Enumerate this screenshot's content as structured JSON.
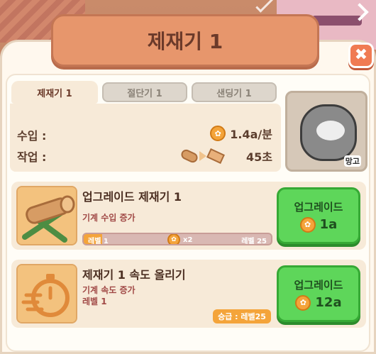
{
  "window": {
    "title": "제재기 1"
  },
  "tabs": [
    {
      "label": "제재기 1",
      "active": true
    },
    {
      "label": "절단기 1",
      "active": false
    },
    {
      "label": "샌딩기 1",
      "active": false
    }
  ],
  "stats": {
    "income_label": "수입 :",
    "income_value": "1.4a/분",
    "work_label": "작업 :",
    "work_value": "45초"
  },
  "worker": {
    "name": "망고"
  },
  "upgrades": [
    {
      "title": "업그레이드 제재기 1",
      "description": "기계 수입 증가",
      "level_left": "레벨 1",
      "level_mid": "x2",
      "level_right": "레벨 25",
      "progress_fraction": 0.1,
      "button_label": "업그레이드",
      "cost": "1a"
    },
    {
      "title": "제재기 1 속도 올리기",
      "description": "기계 속도 증가",
      "level": "레벨 1",
      "promotion": "승급 : 레벨25",
      "button_label": "업그레이드",
      "cost": "12a"
    }
  ],
  "colors": {
    "accent": "#e7966c",
    "button_green": "#5ed65a",
    "coin": "#f4a43a"
  }
}
